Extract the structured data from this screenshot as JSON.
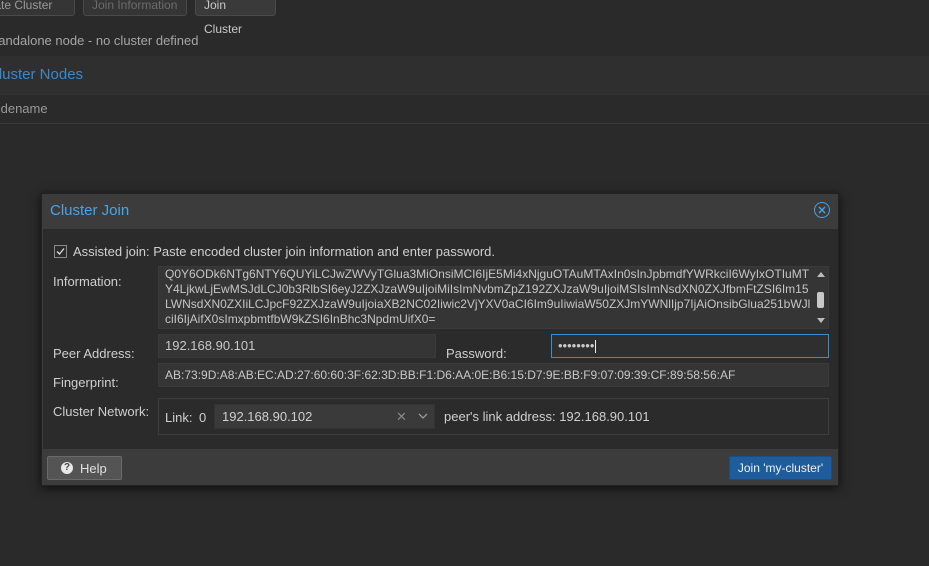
{
  "toolbar": {
    "create_label": "Create Cluster",
    "join_info_label": "Join Information",
    "join_label": "Join Cluster"
  },
  "status_text": "Standalone node - no cluster defined",
  "section_title": "Cluster Nodes",
  "column_header": "Nodename",
  "dialog": {
    "title": "Cluster Join",
    "assisted_label": "Assisted join: Paste encoded cluster join information and enter password.",
    "assisted_checked": true,
    "information_label": "Information:",
    "information_value": "Q0Y6ODk6NTg6NTY6QUYiLCJwZWVyTGlua3MiOnsiMCI6IjE5Mi4xNjguOTAuMTAxIn0sInJpbmdfYWRkciI6WyIxOTIuMTY4LjkwLjEwMSJdLCJ0b3RlbSI6eyJ2ZXJzaW9uIjoiMiIsImNvbmZpZ192ZXJzaW9uIjoiMSIsImNsdXN0ZXJfbmFtZSI6Im15LWNsdXN0ZXIiLCJpcF92ZXJzaW9uIjoiaXB2NC02Iiwic2VjYXV0aCI6Im9uIiwiaW50ZXJmYWNlIjp7IjAiOnsibGlua251bWJlciI6IjAifX0sImxpbmtfbW9kZSI6InBhc3NpdmUifX0=",
    "peer_address_label": "Peer Address:",
    "peer_address_value": "192.168.90.101",
    "password_label": "Password:",
    "password_value": "••••••••",
    "fingerprint_label": "Fingerprint:",
    "fingerprint_value": "AB:73:9D:A8:AB:EC:AD:27:60:60:3F:62:3D:BB:F1:D6:AA:0E:B6:15:D7:9E:BB:F9:07:09:39:CF:89:58:56:AF",
    "cluster_network_label": "Cluster Network:",
    "link_label": "Link:",
    "link_number": "0",
    "link_address": "192.168.90.102",
    "peer_link_text": "peer's link address: 192.168.90.101",
    "help_label": "Help",
    "join_button_label": "Join 'my-cluster'"
  },
  "colors": {
    "accent": "#4aa3e6",
    "primary_button": "#1f5c9b",
    "dialog_bg": "#3c3c3c",
    "page_bg": "#2a2a2a"
  }
}
